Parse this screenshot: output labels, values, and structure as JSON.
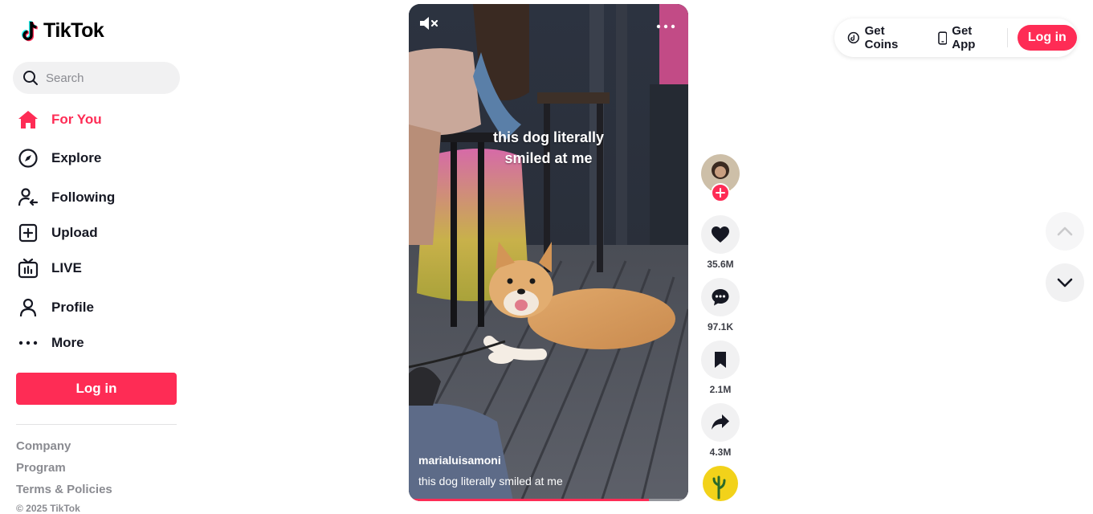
{
  "brand": {
    "name": "TikTok"
  },
  "search": {
    "placeholder": "Search"
  },
  "sidebar": {
    "items": [
      {
        "label": "For You",
        "icon": "home-icon",
        "active": true
      },
      {
        "label": "Explore",
        "icon": "compass-icon"
      },
      {
        "label": "Following",
        "icon": "following-icon"
      },
      {
        "label": "Upload",
        "icon": "upload-icon"
      },
      {
        "label": "LIVE",
        "icon": "live-tv-icon"
      },
      {
        "label": "Profile",
        "icon": "profile-icon"
      },
      {
        "label": "More",
        "icon": "more-dots-icon"
      }
    ],
    "login_label": "Log in",
    "footer": [
      "Company",
      "Program",
      "Terms & Policies"
    ],
    "copyright": "© 2025 TikTok"
  },
  "video": {
    "overlay_caption": "this dog literally smiled at me",
    "author": "marialuisamoni",
    "description": "this dog literally smiled at me",
    "progress": 0.86,
    "muted": true
  },
  "actions": {
    "likes": "35.6M",
    "comments": "97.1K",
    "saves": "2.1M",
    "shares": "4.3M"
  },
  "topbar": {
    "coins_label": "Get Coins",
    "app_label": "Get App",
    "login_label": "Log in"
  },
  "colors": {
    "accent": "#fe2c55",
    "text": "#161823",
    "muted": "#8a8b91"
  }
}
